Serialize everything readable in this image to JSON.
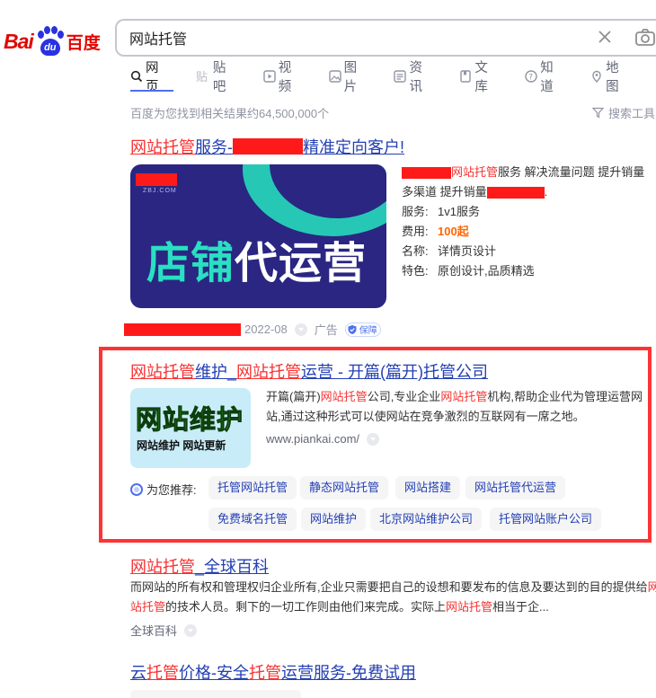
{
  "logo": {
    "bai": "Bai",
    "du": "du",
    "cn": "百度"
  },
  "search": {
    "query": "网站托管"
  },
  "tabs": [
    {
      "label": "网页",
      "icon": "search-icon"
    },
    {
      "label": "贴吧",
      "icon": "tieba-icon"
    },
    {
      "label": "视频",
      "icon": "video-icon"
    },
    {
      "label": "图片",
      "icon": "image-icon"
    },
    {
      "label": "资讯",
      "icon": "news-icon"
    },
    {
      "label": "文库",
      "icon": "doc-icon"
    },
    {
      "label": "知道",
      "icon": "question-icon"
    },
    {
      "label": "地图",
      "icon": "map-icon"
    }
  ],
  "result_count": "百度为您找到相关结果约64,500,000个",
  "tools_label": "搜索工具",
  "ad": {
    "title_em": "网站托管",
    "title_a": "服务-",
    "title_b": "精准定向客户!",
    "image_brand_sub": "ZBJ.COM",
    "image_text_a": "店铺",
    "image_text_b": "代运营",
    "desc_em": "网站托管",
    "desc_a": "服务 解决流量问题 提升销量",
    "desc_b": "多渠道 提升销量",
    "desc_b_end": ".",
    "rows": [
      {
        "k": "服务:",
        "v": "1v1服务"
      },
      {
        "k": "费用:",
        "v": "100起"
      },
      {
        "k": "名称:",
        "v": "详情页设计"
      },
      {
        "k": "特色:",
        "v": "原创设计,品质精选"
      }
    ],
    "date": "2022-08",
    "ad_label": "广告",
    "guarantee": "保障"
  },
  "result2": {
    "title_em1": "网站托管",
    "title_a": "维护",
    "title_sep": "_",
    "title_em2": "网站托管",
    "title_b": "运营 - 开篇(篇开)托管公司",
    "thumb_big": "网站维护",
    "thumb_sub": "网站维护 网站更新",
    "snippet_a": "开篇(篇开)",
    "snippet_em1": "网站托管",
    "snippet_b": "公司,专业企业",
    "snippet_em2": "网站托管",
    "snippet_c": "机构,帮助企业代为管理运营网站,通过这种形式可以使网站在竞争激烈的互联网有一席之地。",
    "site": "www.piankai.com/",
    "rec_label": "为您推荐:",
    "chips_row1": [
      "托管网站托管",
      "静态网站托管",
      "网站搭建",
      "网站托管代运营"
    ],
    "chips_row2": [
      "免费域名托管",
      "网站维护",
      "北京网站维护公司",
      "托管网站账户公司"
    ]
  },
  "result3": {
    "title_em": "网站托管",
    "title_sep": "_",
    "title_b": "全球百科",
    "snippet_a": "而网站的所有权和管理权归企业所有,企业只需要把自己的设想和要发布的信息及要达到的目的提供给",
    "snippet_em1": "网站托管",
    "snippet_b": "的技术人员。剩下的一切工作则由他们来完成。实际上",
    "snippet_em2": "网站托管",
    "snippet_c": "相当于企...",
    "source": "全球百科"
  },
  "result4": {
    "t_a": "云",
    "t_em1": "托管",
    "t_b": "价格-安全",
    "t_em2": "托管",
    "t_c": "运营服务-免费试用"
  }
}
